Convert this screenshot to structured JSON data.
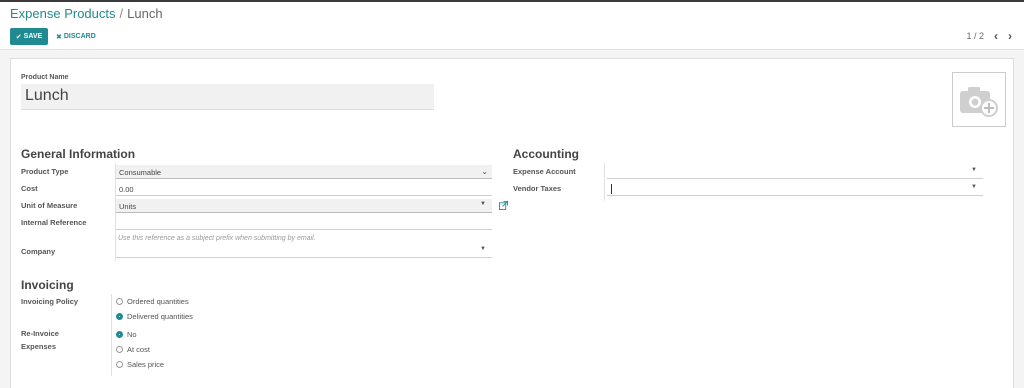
{
  "breadcrumb": {
    "parent": "Expense Products",
    "separator": "/",
    "current": "Lunch"
  },
  "toolbar": {
    "save_label": "SAVE",
    "discard_label": "DISCARD"
  },
  "pager": {
    "value": "1 / 2",
    "prev_icon": "chevron-left-icon",
    "next_icon": "chevron-right-icon"
  },
  "form": {
    "product_name_label": "Product Name",
    "product_name_value": "Lunch",
    "image_icon": "camera-plus-icon"
  },
  "general": {
    "title": "General Information",
    "product_type_label": "Product Type",
    "product_type_value": "Consumable",
    "cost_label": "Cost",
    "cost_value": "0.00",
    "uom_label": "Unit of Measure",
    "uom_value": "Units",
    "internal_ref_label": "Internal Reference",
    "internal_ref_value": "",
    "internal_ref_hint": "Use this reference as a subject prefix when submitting by email.",
    "company_label": "Company",
    "company_value": ""
  },
  "accounting": {
    "title": "Accounting",
    "expense_account_label": "Expense Account",
    "expense_account_value": "",
    "vendor_taxes_label": "Vendor Taxes",
    "vendor_taxes_value": ""
  },
  "invoicing": {
    "title": "Invoicing",
    "policy_label": "Invoicing Policy",
    "policy_options": [
      "Ordered quantities",
      "Delivered quantities"
    ],
    "policy_selected": "Delivered quantities",
    "reinvoice_label_line1": "Re-Invoice",
    "reinvoice_label_line2": "Expenses",
    "reinvoice_options": [
      "No",
      "At cost",
      "Sales price"
    ],
    "reinvoice_selected": "No"
  },
  "colors": {
    "accent": "#1f8a91",
    "background": "#f4f4f5",
    "sheet": "#ffffff"
  }
}
